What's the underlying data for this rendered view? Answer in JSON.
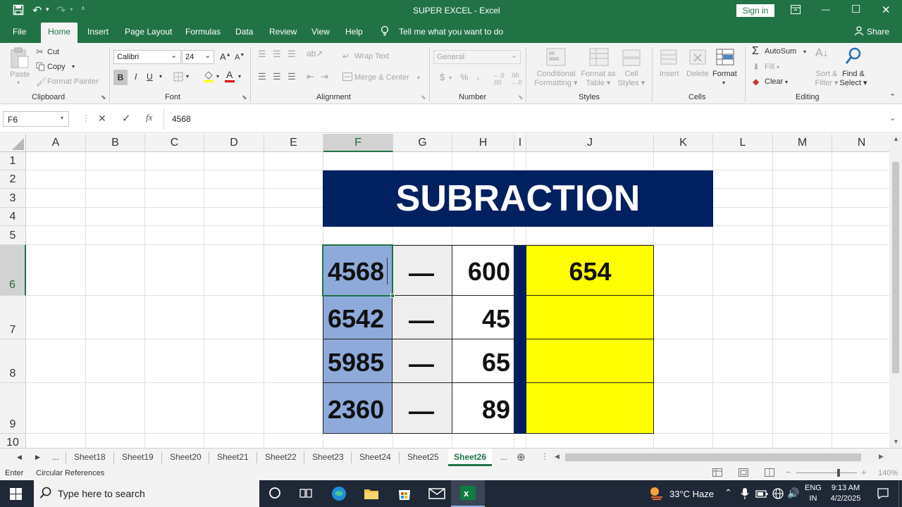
{
  "window": {
    "title": "SUPER EXCEL  -  Excel",
    "sign_in": "Sign in",
    "minimize": "—",
    "maximize": "☐",
    "close": "✕"
  },
  "ribbon_tabs": [
    "File",
    "Home",
    "Insert",
    "Page Layout",
    "Formulas",
    "Data",
    "Review",
    "View",
    "Help"
  ],
  "tell_me": "Tell me what you want to do",
  "share": "Share",
  "clipboard": {
    "paste": "Paste",
    "cut": "Cut",
    "copy": "Copy",
    "format_painter": "Format Painter",
    "label": "Clipboard"
  },
  "font": {
    "name": "Calibri",
    "size": "24",
    "bold": "B",
    "italic": "I",
    "underline": "U",
    "label": "Font"
  },
  "alignment": {
    "wrap_text": "Wrap Text",
    "merge_center": "Merge & Center",
    "label": "Alignment"
  },
  "number": {
    "format": "General",
    "currency": "$",
    "percent": "%",
    "comma": ",",
    "label": "Number"
  },
  "styles": {
    "conditional": "Conditional",
    "conditional2": "Formatting",
    "format_as": "Format as",
    "format_as2": "Table",
    "cell": "Cell",
    "cell2": "Styles",
    "label": "Styles"
  },
  "cells": {
    "insert": "Insert",
    "delete": "Delete",
    "format": "Format",
    "label": "Cells"
  },
  "editing": {
    "autosum": "AutoSum",
    "fill": "Fill",
    "clear": "Clear",
    "sort": "Sort &",
    "sort2": "Filter",
    "find": "Find &",
    "find2": "Select",
    "label": "Editing"
  },
  "formula_bar": {
    "name_box": "F6",
    "cancel": "✕",
    "enter": "✓",
    "fx": "fx",
    "content": "4568"
  },
  "columns": [
    "A",
    "B",
    "C",
    "D",
    "E",
    "F",
    "G",
    "H",
    "I",
    "J",
    "K",
    "L",
    "M",
    "N"
  ],
  "rows": [
    "1",
    "2",
    "3",
    "4",
    "5",
    "6",
    "7",
    "8",
    "9",
    "10"
  ],
  "sheet": {
    "banner": "SUBRACTION",
    "left_values": [
      "4568",
      "6542",
      "5985",
      "2360"
    ],
    "operators": [
      "—",
      "—",
      "—",
      "—"
    ],
    "right_values": [
      "600",
      "45",
      "65",
      "89"
    ],
    "results": [
      "654",
      "",
      "",
      ""
    ],
    "colors": {
      "banner": "#002060",
      "selected": "#8eaadb",
      "operator_bg": "#eeeeee",
      "result": "#ffff00"
    }
  },
  "sheet_tabs": [
    "...",
    "Sheet18",
    "Sheet19",
    "Sheet20",
    "Sheet21",
    "Sheet22",
    "Sheet23",
    "Sheet24",
    "Sheet25",
    "Sheet26",
    "..."
  ],
  "active_sheet": "Sheet26",
  "status": {
    "mode": "Enter",
    "circular": "Circular References",
    "zoom": "140%"
  },
  "taskbar": {
    "search_placeholder": "Type here to search",
    "weather": "33°C  Haze",
    "lang1": "ENG",
    "lang2": "IN",
    "time": "9:13 AM",
    "date": "4/2/2025"
  }
}
